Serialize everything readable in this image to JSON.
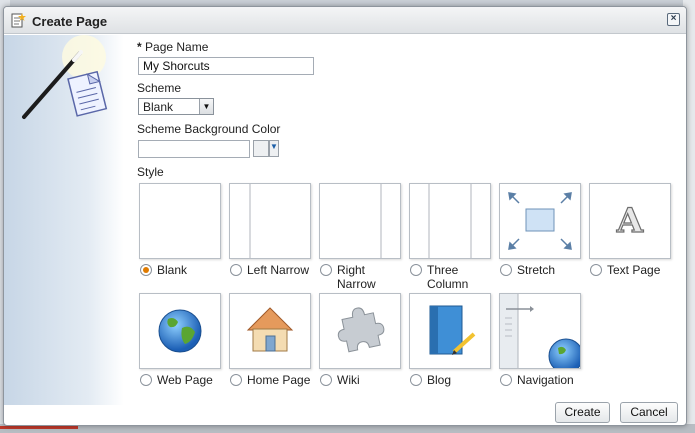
{
  "dialog": {
    "title": "Create Page",
    "close_label": "×"
  },
  "form": {
    "page_name": {
      "required_marker": "*",
      "label": "Page Name",
      "value": "My Shorcuts"
    },
    "scheme": {
      "label": "Scheme",
      "value": "Blank"
    },
    "scheme_bg_color": {
      "label": "Scheme Background Color",
      "value": ""
    },
    "style": {
      "label": "Style",
      "selected": "Blank",
      "options": [
        {
          "label": "Blank",
          "icon": "blank-layout-icon"
        },
        {
          "label": "Left Narrow",
          "icon": "left-narrow-layout-icon"
        },
        {
          "label": "Right Narrow",
          "icon": "right-narrow-layout-icon"
        },
        {
          "label": "Three Column",
          "icon": "three-column-layout-icon"
        },
        {
          "label": "Stretch",
          "icon": "stretch-layout-icon"
        },
        {
          "label": "Text Page",
          "icon": "text-page-icon"
        },
        {
          "label": "Web Page",
          "icon": "globe-icon"
        },
        {
          "label": "Home Page",
          "icon": "house-icon"
        },
        {
          "label": "Wiki",
          "icon": "puzzle-piece-icon"
        },
        {
          "label": "Blog",
          "icon": "book-pencil-icon"
        },
        {
          "label": "Navigation",
          "icon": "navigation-globe-icon"
        }
      ]
    }
  },
  "buttons": {
    "create": "Create",
    "cancel": "Cancel"
  },
  "colors": {
    "selected_radio": "#e07b00",
    "stretch_box": "#cfe2f5"
  }
}
